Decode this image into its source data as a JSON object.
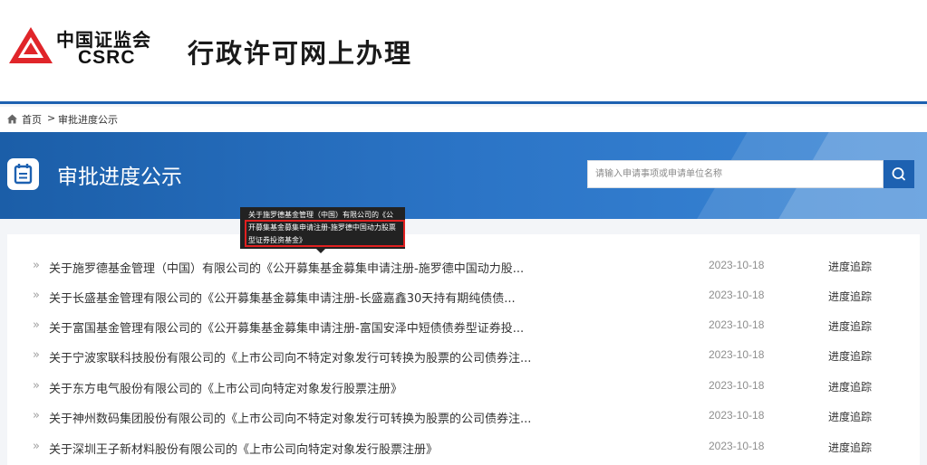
{
  "header": {
    "logo_cn": "中国证监会",
    "logo_en": "CSRC",
    "site_title": "行政许可网上办理",
    "brand_color": "#e0252a",
    "accent_color": "#1d61b1"
  },
  "breadcrumb": {
    "home": "首页",
    "separator": ">",
    "current": "审批进度公示"
  },
  "banner": {
    "title": "审批进度公示",
    "icon": "calendar-icon"
  },
  "search": {
    "placeholder": "请输入申请事项或申请单位名称",
    "icon": "search-icon"
  },
  "tooltip": {
    "text": "关于施罗德基金管理（中国）有限公司的《公开募集基金募集申请注册-施罗德中国动力股票型证券投资基金》"
  },
  "list": {
    "rows": [
      {
        "bullet": "»",
        "title": "关于施罗德基金管理（中国）有限公司的《公开募集基金募集申请注册-施罗德中国动力股...",
        "date": "2023-10-18",
        "action": "进度追踪"
      },
      {
        "bullet": "»",
        "title": "关于长盛基金管理有限公司的《公开募集基金募集申请注册-长盛嘉鑫30天持有期纯债债...",
        "date": "2023-10-18",
        "action": "进度追踪"
      },
      {
        "bullet": "»",
        "title": "关于富国基金管理有限公司的《公开募集基金募集申请注册-富国安泽中短债债券型证券投...",
        "date": "2023-10-18",
        "action": "进度追踪"
      },
      {
        "bullet": "»",
        "title": "关于宁波家联科技股份有限公司的《上市公司向不特定对象发行可转换为股票的公司债券注...",
        "date": "2023-10-18",
        "action": "进度追踪"
      },
      {
        "bullet": "»",
        "title": "关于东方电气股份有限公司的《上市公司向特定对象发行股票注册》",
        "date": "2023-10-18",
        "action": "进度追踪"
      },
      {
        "bullet": "»",
        "title": "关于神州数码集团股份有限公司的《上市公司向不特定对象发行可转换为股票的公司债券注...",
        "date": "2023-10-18",
        "action": "进度追踪"
      },
      {
        "bullet": "»",
        "title": "关于深圳王子新材料股份有限公司的《上市公司向特定对象发行股票注册》",
        "date": "2023-10-18",
        "action": "进度追踪"
      }
    ]
  }
}
